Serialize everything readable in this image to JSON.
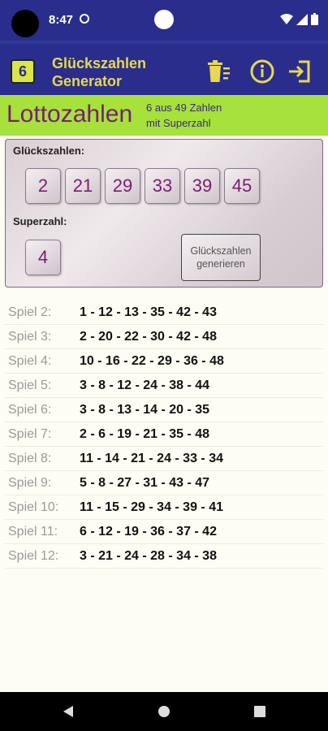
{
  "status": {
    "time": "8:47"
  },
  "app": {
    "logo_label": "6",
    "title_line1": "Glückszahlen",
    "title_line2": "Generator"
  },
  "header": {
    "title": "Lottozahlen",
    "subtitle_line1": "6 aus 49 Zahlen",
    "subtitle_line2": "mit Superzahl"
  },
  "panel": {
    "lucky_label": "Glückszahlen:",
    "numbers": [
      "2",
      "21",
      "29",
      "33",
      "39",
      "45"
    ],
    "super_label": "Superzahl:",
    "super_number": "4",
    "generate_line1": "Glückszahlen",
    "generate_line2": "generieren"
  },
  "games": [
    {
      "label": "Spiel 2:",
      "numbers": "1 - 12 - 13 - 35 - 42 - 43"
    },
    {
      "label": "Spiel 3:",
      "numbers": "2 - 20 - 22 - 30 - 42 - 48"
    },
    {
      "label": "Spiel 4:",
      "numbers": "10 - 16 - 22 - 29 - 36 - 48"
    },
    {
      "label": "Spiel 5:",
      "numbers": "3 - 8 - 12 - 24 - 38 - 44"
    },
    {
      "label": "Spiel 6:",
      "numbers": "3 - 8 - 13 - 14 - 20 - 35"
    },
    {
      "label": "Spiel 7:",
      "numbers": "2 - 6 - 19 - 21 - 35 - 48"
    },
    {
      "label": "Spiel 8:",
      "numbers": "11 - 14 - 21 - 24 - 33 - 34"
    },
    {
      "label": "Spiel 9:",
      "numbers": "5 - 8 - 27 - 31 - 43 - 47"
    },
    {
      "label": "Spiel 10:",
      "numbers": "11 - 15 - 29 - 34 - 39 - 41"
    },
    {
      "label": "Spiel 11:",
      "numbers": "6 - 12 - 19 - 36 - 37 - 42"
    },
    {
      "label": "Spiel 12:",
      "numbers": "3 - 21 - 24 - 28 - 34 - 38"
    }
  ],
  "colors": {
    "appbar": "#2b2d8c",
    "header": "#a6e13c",
    "accent": "#7a1e6f",
    "title_yellow": "#e6d94f"
  },
  "icons": [
    "delete-icon",
    "info-icon",
    "exit-icon",
    "back-icon",
    "home-icon",
    "recents-icon"
  ]
}
